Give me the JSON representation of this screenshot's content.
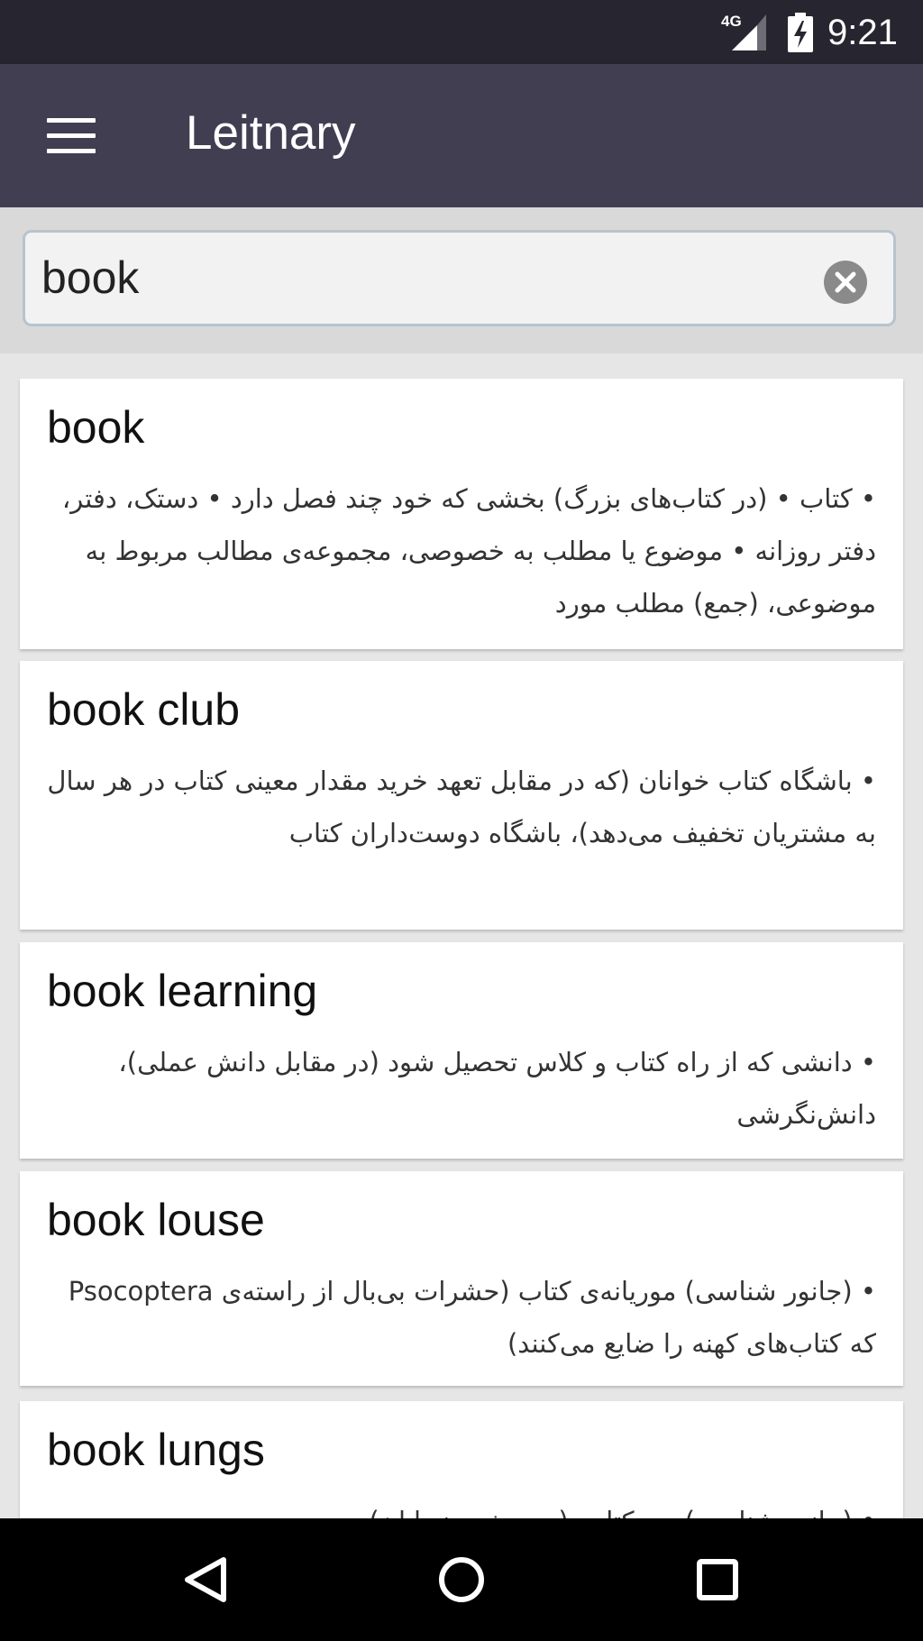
{
  "status_bar": {
    "network": "4G",
    "time": "9:21",
    "icons": [
      "signal-4g-icon",
      "battery-charging-icon"
    ]
  },
  "app_bar": {
    "title": "Leitnary",
    "menu_icon": "hamburger-menu-icon"
  },
  "search": {
    "value": "book",
    "clear_icon": "clear-icon"
  },
  "results": [
    {
      "word": "book",
      "definition": "• کتاب • (در کتاب‌های بزرگ) بخشی که خود چند فصل دارد • دستک، دفتر، دفتر روزانه • موضوع یا مطلب به خصوصی، مجموعه‌ی مطالب مربوط به موضوعی، (جمع) مطلب مورد"
    },
    {
      "word": "book club",
      "definition": "• باشگاه کتاب خوانان (که در مقابل تعهد خرید مقدار معینی کتاب در هر سال به مشتریان تخفیف می‌دهد)، باشگاه دوست‌داران کتاب"
    },
    {
      "word": "book learning",
      "definition": "• دانشی که از راه کتاب و کلاس تحصیل شود (در مقابل دانش عملی)، دانش‌نگرشی"
    },
    {
      "word": "book louse",
      "definition": "• (جانور شناسی) موریانه‌ی کتاب (حشرات بی‌بال از راسته‌ی Psocoptera که کتاب‌های کهنه را ضایع می‌کنند)"
    },
    {
      "word": "book lungs",
      "definition": "• (جانور شناسی) ریه کتابی (در برخی بندپایان)"
    }
  ],
  "colors": {
    "status_bar": "#27252f",
    "app_bar": "#413e52",
    "search_area": "#d9d9d9",
    "search_border": "#b8c3cd",
    "list_background": "#e6e6e6",
    "card": "#ffffff",
    "nav_bar": "#000000"
  },
  "nav_bar": {
    "icons": [
      "back-icon",
      "home-icon",
      "recents-icon"
    ]
  }
}
